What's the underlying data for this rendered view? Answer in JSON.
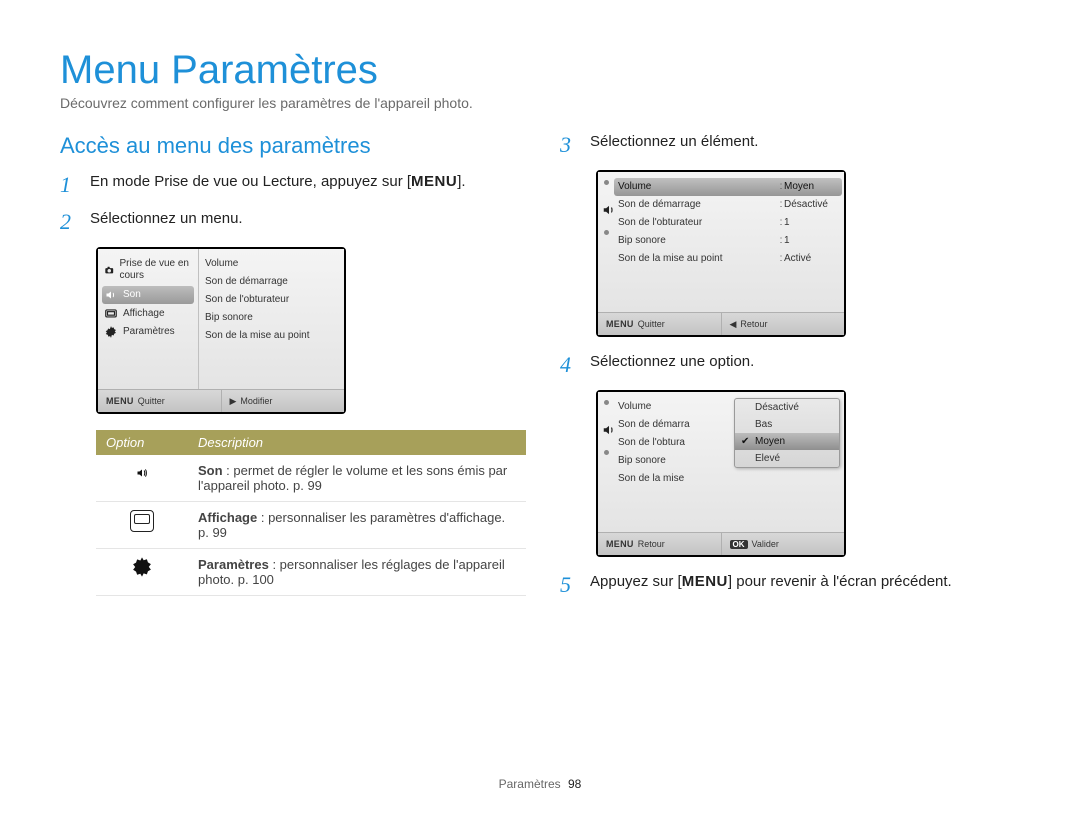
{
  "title": "Menu Paramètres",
  "subtitle": "Découvrez comment configurer les paramètres de l'appareil photo.",
  "section": "Accès au menu des paramètres",
  "menu_button_label": "MENU",
  "steps": {
    "s1_pre": "En mode Prise de vue ou Lecture, appuyez sur [",
    "s1_post": "].",
    "s2": "Sélectionnez un menu.",
    "s3": "Sélectionnez un élément.",
    "s4": "Sélectionnez une option.",
    "s5_pre": "Appuyez sur [",
    "s5_post": "] pour revenir à l'écran précédent."
  },
  "nums": {
    "n1": "1",
    "n2": "2",
    "n3": "3",
    "n4": "4",
    "n5": "5"
  },
  "screen2": {
    "left": {
      "items": [
        "Prise de vue en cours",
        "Son",
        "Affichage",
        "Paramètres"
      ],
      "selected_index": 1
    },
    "right": {
      "items": [
        "Volume",
        "Son de démarrage",
        "Son de l'obturateur",
        "Bip sonore",
        "Son de la mise au point"
      ]
    },
    "footer_left": "Quitter",
    "footer_right": "Modifier"
  },
  "screen3": {
    "rows": [
      {
        "label": "Volume",
        "value": "Moyen",
        "selected": true
      },
      {
        "label": "Son de démarrage",
        "value": "Désactivé"
      },
      {
        "label": "Son de l'obturateur",
        "value": "1"
      },
      {
        "label": "Bip sonore",
        "value": "1"
      },
      {
        "label": "Son de la mise au point",
        "value": "Activé"
      }
    ],
    "footer_left": "Quitter",
    "footer_right": "Retour"
  },
  "screen4": {
    "rows": [
      {
        "label": "Volume"
      },
      {
        "label": "Son de démarra"
      },
      {
        "label": "Son de l'obtura"
      },
      {
        "label": "Bip sonore"
      },
      {
        "label": "Son de la mise"
      }
    ],
    "dropdown": {
      "options": [
        "Désactivé",
        "Bas",
        "Moyen",
        "Elevé"
      ],
      "selected_index": 2
    },
    "footer_left": "Retour",
    "footer_right": "Valider",
    "ok_label": "OK"
  },
  "table": {
    "headers": {
      "option": "Option",
      "description": "Description"
    },
    "rows": [
      {
        "icon": "speaker",
        "name": "Son",
        "text": " : permet de régler le volume et les sons émis par l'appareil photo. p. 99"
      },
      {
        "icon": "display",
        "name": "Affichage",
        "text": " : personnaliser les paramètres d'affichage. p. 99"
      },
      {
        "icon": "gear",
        "name": "Paramètres",
        "text": " : personnaliser les réglages de l'appareil photo. p. 100"
      }
    ]
  },
  "footer": {
    "label": "Paramètres",
    "page": "98"
  }
}
